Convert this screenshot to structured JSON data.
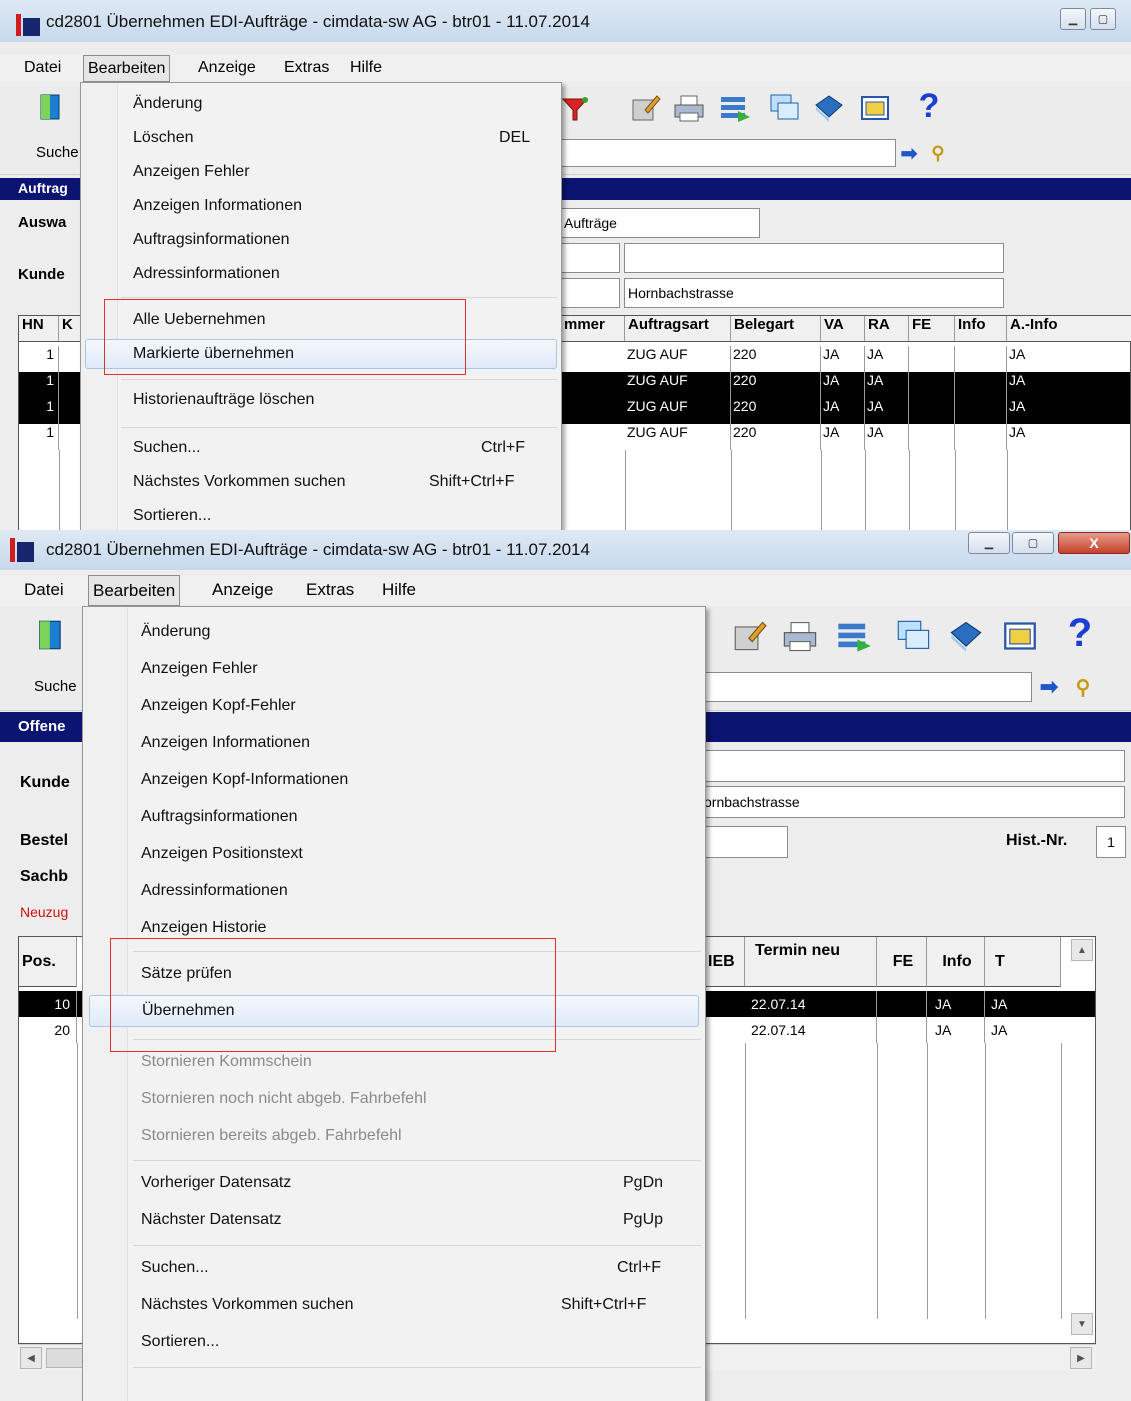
{
  "top": {
    "title": "cd2801 Übernehmen EDI-Aufträge - cimdata-sw AG - btr01 - 11.07.2014",
    "menu": [
      "Datei",
      "Bearbeiten",
      "Anzeige",
      "Extras",
      "Hilfe"
    ],
    "search_label": "Suche",
    "band_label": "Auftrag",
    "labels": {
      "auswahl": "Auswa",
      "kunde": "Kunde"
    },
    "fields": {
      "auswahl_value": "Aufträge",
      "kunde_street": "Hornbachstrasse"
    },
    "grid": {
      "headers_left": [
        "HN",
        "K"
      ],
      "headers_right": [
        "mmer",
        "Auftragsart",
        "Belegart",
        "VA",
        "RA",
        "FE",
        "Info",
        "A.-Info"
      ],
      "rows": [
        {
          "hn": "1",
          "art": "ZUG AUF",
          "beleg": "220",
          "va": "JA",
          "ra": "JA",
          "fe": "",
          "info": "",
          "ainfo": "JA"
        },
        {
          "hn": "1",
          "art": "ZUG AUF",
          "beleg": "220",
          "va": "JA",
          "ra": "JA",
          "fe": "",
          "info": "",
          "ainfo": "JA"
        },
        {
          "hn": "1",
          "art": "ZUG AUF",
          "beleg": "220",
          "va": "JA",
          "ra": "JA",
          "fe": "",
          "info": "",
          "ainfo": "JA"
        },
        {
          "hn": "1",
          "art": "ZUG AUF",
          "beleg": "220",
          "va": "JA",
          "ra": "JA",
          "fe": "",
          "info": "",
          "ainfo": "JA"
        }
      ]
    },
    "dropdown": [
      {
        "label": "Änderung",
        "shortcut": ""
      },
      {
        "label": "Löschen",
        "shortcut": "DEL"
      },
      {
        "label": "Anzeigen Fehler",
        "shortcut": ""
      },
      {
        "label": "Anzeigen Informationen",
        "shortcut": ""
      },
      {
        "label": "Auftragsinformationen",
        "shortcut": ""
      },
      {
        "label": "Adressinformationen",
        "shortcut": ""
      },
      {
        "label": "Alle Uebernehmen",
        "shortcut": ""
      },
      {
        "label": "Markierte übernehmen",
        "shortcut": ""
      },
      {
        "label": "Historienaufträge löschen",
        "shortcut": ""
      },
      {
        "label": "Suchen...",
        "shortcut": "Ctrl+F"
      },
      {
        "label": "Nächstes Vorkommen suchen",
        "shortcut": "Shift+Ctrl+F"
      },
      {
        "label": "Sortieren...",
        "shortcut": ""
      }
    ]
  },
  "bottom": {
    "title": "cd2801 Übernehmen EDI-Aufträge - cimdata-sw AG - btr01 - 11.07.2014",
    "menu": [
      "Datei",
      "Bearbeiten",
      "Anzeige",
      "Extras",
      "Hilfe"
    ],
    "search_label": "Suche",
    "band_label": "Offene",
    "labels": {
      "kunde": "Kunde",
      "bestell": "Bestel",
      "sachb": "Sachb",
      "hist": "Hist.-Nr."
    },
    "red_label": "Neuzug",
    "fields": {
      "street": "ornbachstrasse",
      "hist_value": "1"
    },
    "grid": {
      "header_pos": "Pos.",
      "header_heb": "IEB",
      "header_termin": "Termin neu",
      "header_fe": "FE",
      "header_info": "Info",
      "header_t": "T",
      "rows": [
        {
          "pos": "10",
          "termin": "22.07.14",
          "info": "JA",
          "t": "JA"
        },
        {
          "pos": "20",
          "termin": "22.07.14",
          "info": "JA",
          "t": "JA"
        }
      ]
    },
    "dropdown": [
      {
        "label": "Änderung",
        "shortcut": ""
      },
      {
        "label": "Anzeigen Fehler",
        "shortcut": ""
      },
      {
        "label": "Anzeigen Kopf-Fehler",
        "shortcut": ""
      },
      {
        "label": "Anzeigen Informationen",
        "shortcut": ""
      },
      {
        "label": "Anzeigen Kopf-Informationen",
        "shortcut": ""
      },
      {
        "label": "Auftragsinformationen",
        "shortcut": ""
      },
      {
        "label": "Anzeigen Positionstext",
        "shortcut": ""
      },
      {
        "label": "Adressinformationen",
        "shortcut": ""
      },
      {
        "label": "Anzeigen Historie",
        "shortcut": ""
      },
      {
        "label": "Sätze prüfen",
        "shortcut": ""
      },
      {
        "label": "Übernehmen",
        "shortcut": ""
      },
      {
        "label": "Stornieren Kommschein",
        "shortcut": ""
      },
      {
        "label": "Stornieren noch nicht abgeb. Fahrbefehl",
        "shortcut": ""
      },
      {
        "label": "Stornieren bereits abgeb. Fahrbefehl",
        "shortcut": ""
      },
      {
        "label": "Vorheriger Datensatz",
        "shortcut": "PgDn"
      },
      {
        "label": "Nächster Datensatz",
        "shortcut": "PgUp"
      },
      {
        "label": "Suchen...",
        "shortcut": "Ctrl+F"
      },
      {
        "label": "Nächstes Vorkommen suchen",
        "shortcut": "Shift+Ctrl+F"
      },
      {
        "label": "Sortieren...",
        "shortcut": ""
      }
    ]
  }
}
